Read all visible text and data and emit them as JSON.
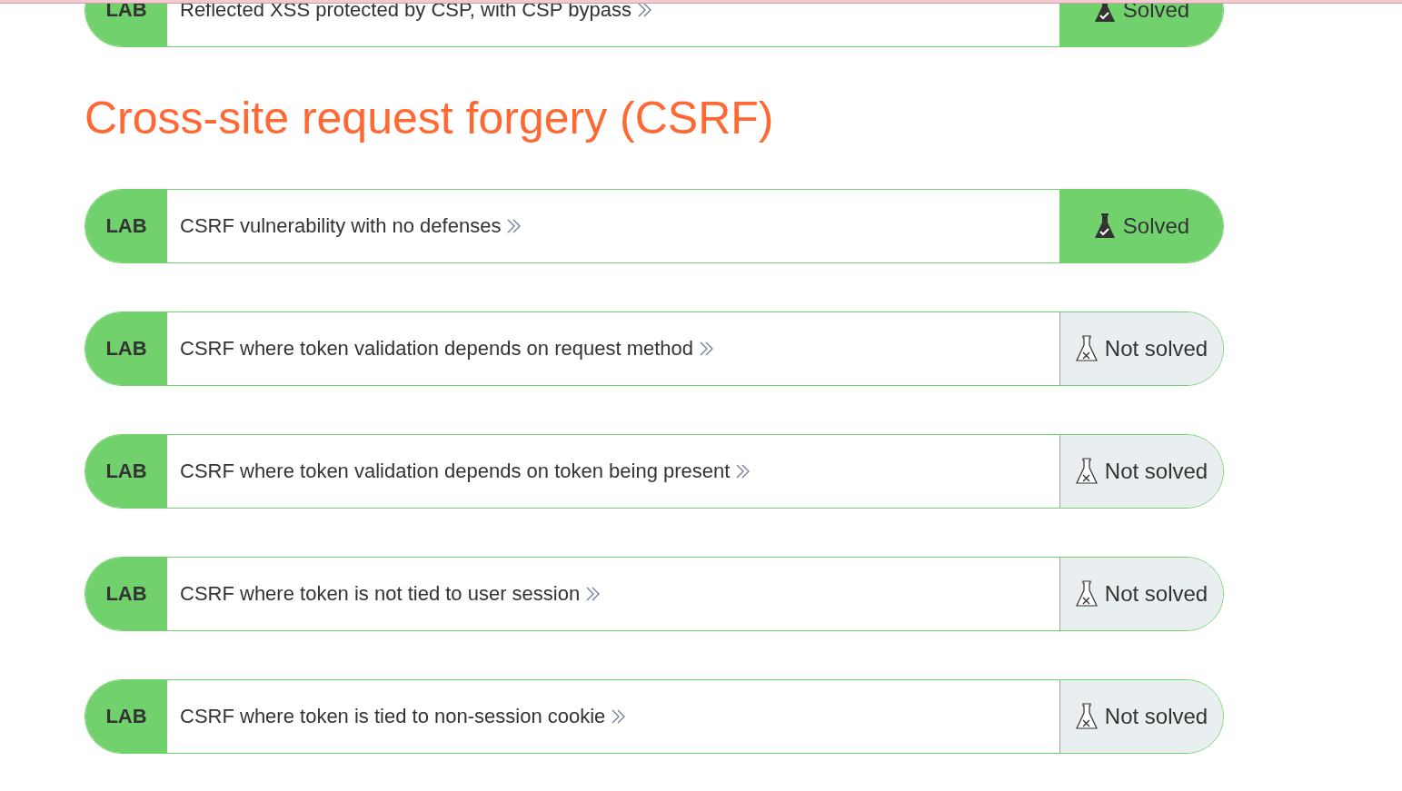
{
  "items": [
    {
      "kind": "lab",
      "badge": "LAB",
      "title": "Reflected XSS protected by CSP, with CSP bypass",
      "solved": true,
      "status": "Solved"
    },
    {
      "kind": "heading",
      "title": "Cross-site request forgery (CSRF)"
    },
    {
      "kind": "lab",
      "badge": "LAB",
      "title": "CSRF vulnerability with no defenses",
      "solved": true,
      "status": "Solved"
    },
    {
      "kind": "lab",
      "badge": "LAB",
      "title": "CSRF where token validation depends on request method",
      "solved": false,
      "status": "Not solved"
    },
    {
      "kind": "lab",
      "badge": "LAB",
      "title": "CSRF where token validation depends on token being present",
      "solved": false,
      "status": "Not solved"
    },
    {
      "kind": "lab",
      "badge": "LAB",
      "title": "CSRF where token is not tied to user session",
      "solved": false,
      "status": "Not solved"
    },
    {
      "kind": "lab",
      "badge": "LAB",
      "title": "CSRF where token is tied to non-session cookie",
      "solved": false,
      "status": "Not solved"
    }
  ]
}
